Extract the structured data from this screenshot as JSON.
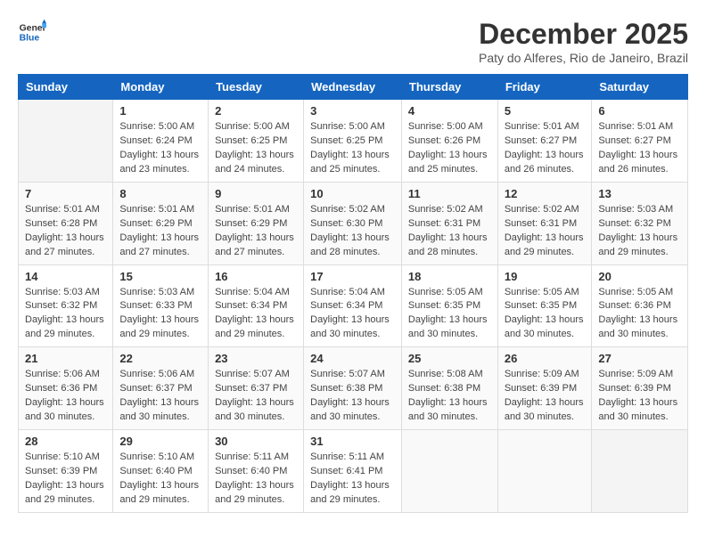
{
  "logo": {
    "line1": "General",
    "line2": "Blue"
  },
  "title": "December 2025",
  "location": "Paty do Alferes, Rio de Janeiro, Brazil",
  "weekdays": [
    "Sunday",
    "Monday",
    "Tuesday",
    "Wednesday",
    "Thursday",
    "Friday",
    "Saturday"
  ],
  "weeks": [
    [
      {
        "day": "",
        "text": ""
      },
      {
        "day": "1",
        "text": "Sunrise: 5:00 AM\nSunset: 6:24 PM\nDaylight: 13 hours\nand 23 minutes."
      },
      {
        "day": "2",
        "text": "Sunrise: 5:00 AM\nSunset: 6:25 PM\nDaylight: 13 hours\nand 24 minutes."
      },
      {
        "day": "3",
        "text": "Sunrise: 5:00 AM\nSunset: 6:25 PM\nDaylight: 13 hours\nand 25 minutes."
      },
      {
        "day": "4",
        "text": "Sunrise: 5:00 AM\nSunset: 6:26 PM\nDaylight: 13 hours\nand 25 minutes."
      },
      {
        "day": "5",
        "text": "Sunrise: 5:01 AM\nSunset: 6:27 PM\nDaylight: 13 hours\nand 26 minutes."
      },
      {
        "day": "6",
        "text": "Sunrise: 5:01 AM\nSunset: 6:27 PM\nDaylight: 13 hours\nand 26 minutes."
      }
    ],
    [
      {
        "day": "7",
        "text": "Sunrise: 5:01 AM\nSunset: 6:28 PM\nDaylight: 13 hours\nand 27 minutes."
      },
      {
        "day": "8",
        "text": "Sunrise: 5:01 AM\nSunset: 6:29 PM\nDaylight: 13 hours\nand 27 minutes."
      },
      {
        "day": "9",
        "text": "Sunrise: 5:01 AM\nSunset: 6:29 PM\nDaylight: 13 hours\nand 27 minutes."
      },
      {
        "day": "10",
        "text": "Sunrise: 5:02 AM\nSunset: 6:30 PM\nDaylight: 13 hours\nand 28 minutes."
      },
      {
        "day": "11",
        "text": "Sunrise: 5:02 AM\nSunset: 6:31 PM\nDaylight: 13 hours\nand 28 minutes."
      },
      {
        "day": "12",
        "text": "Sunrise: 5:02 AM\nSunset: 6:31 PM\nDaylight: 13 hours\nand 29 minutes."
      },
      {
        "day": "13",
        "text": "Sunrise: 5:03 AM\nSunset: 6:32 PM\nDaylight: 13 hours\nand 29 minutes."
      }
    ],
    [
      {
        "day": "14",
        "text": "Sunrise: 5:03 AM\nSunset: 6:32 PM\nDaylight: 13 hours\nand 29 minutes."
      },
      {
        "day": "15",
        "text": "Sunrise: 5:03 AM\nSunset: 6:33 PM\nDaylight: 13 hours\nand 29 minutes."
      },
      {
        "day": "16",
        "text": "Sunrise: 5:04 AM\nSunset: 6:34 PM\nDaylight: 13 hours\nand 29 minutes."
      },
      {
        "day": "17",
        "text": "Sunrise: 5:04 AM\nSunset: 6:34 PM\nDaylight: 13 hours\nand 30 minutes."
      },
      {
        "day": "18",
        "text": "Sunrise: 5:05 AM\nSunset: 6:35 PM\nDaylight: 13 hours\nand 30 minutes."
      },
      {
        "day": "19",
        "text": "Sunrise: 5:05 AM\nSunset: 6:35 PM\nDaylight: 13 hours\nand 30 minutes."
      },
      {
        "day": "20",
        "text": "Sunrise: 5:05 AM\nSunset: 6:36 PM\nDaylight: 13 hours\nand 30 minutes."
      }
    ],
    [
      {
        "day": "21",
        "text": "Sunrise: 5:06 AM\nSunset: 6:36 PM\nDaylight: 13 hours\nand 30 minutes."
      },
      {
        "day": "22",
        "text": "Sunrise: 5:06 AM\nSunset: 6:37 PM\nDaylight: 13 hours\nand 30 minutes."
      },
      {
        "day": "23",
        "text": "Sunrise: 5:07 AM\nSunset: 6:37 PM\nDaylight: 13 hours\nand 30 minutes."
      },
      {
        "day": "24",
        "text": "Sunrise: 5:07 AM\nSunset: 6:38 PM\nDaylight: 13 hours\nand 30 minutes."
      },
      {
        "day": "25",
        "text": "Sunrise: 5:08 AM\nSunset: 6:38 PM\nDaylight: 13 hours\nand 30 minutes."
      },
      {
        "day": "26",
        "text": "Sunrise: 5:09 AM\nSunset: 6:39 PM\nDaylight: 13 hours\nand 30 minutes."
      },
      {
        "day": "27",
        "text": "Sunrise: 5:09 AM\nSunset: 6:39 PM\nDaylight: 13 hours\nand 30 minutes."
      }
    ],
    [
      {
        "day": "28",
        "text": "Sunrise: 5:10 AM\nSunset: 6:39 PM\nDaylight: 13 hours\nand 29 minutes."
      },
      {
        "day": "29",
        "text": "Sunrise: 5:10 AM\nSunset: 6:40 PM\nDaylight: 13 hours\nand 29 minutes."
      },
      {
        "day": "30",
        "text": "Sunrise: 5:11 AM\nSunset: 6:40 PM\nDaylight: 13 hours\nand 29 minutes."
      },
      {
        "day": "31",
        "text": "Sunrise: 5:11 AM\nSunset: 6:41 PM\nDaylight: 13 hours\nand 29 minutes."
      },
      {
        "day": "",
        "text": ""
      },
      {
        "day": "",
        "text": ""
      },
      {
        "day": "",
        "text": ""
      }
    ]
  ]
}
